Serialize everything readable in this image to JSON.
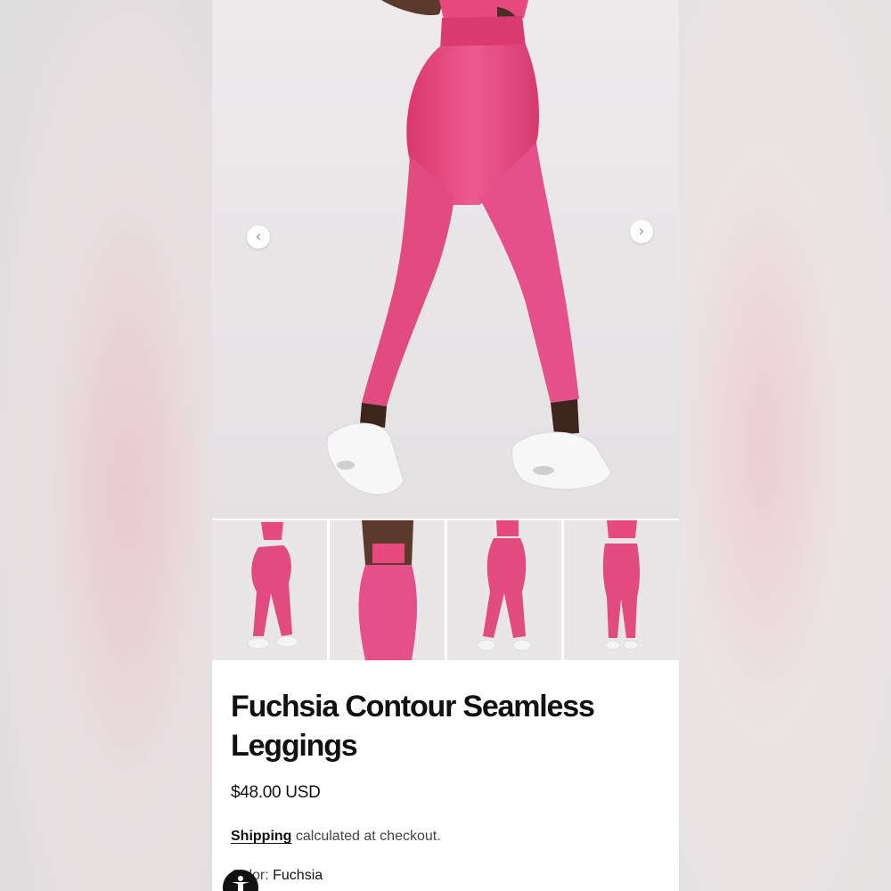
{
  "product": {
    "title": "Fuchsia Contour Seamless Leggings",
    "price": "$48.00 USD",
    "shipping_link": "Shipping",
    "shipping_text": " calculated at checkout.",
    "color_label": "Color:",
    "color_value": " Fuchsia"
  },
  "gallery": {
    "prev_icon": "chevron-left-icon",
    "next_icon": "chevron-right-icon",
    "thumbnail_count": 4
  },
  "colors": {
    "accent": "#e8407c",
    "text": "#111111",
    "muted": "#444444"
  },
  "widgets": {
    "accessibility_icon": "accessibility-icon"
  }
}
